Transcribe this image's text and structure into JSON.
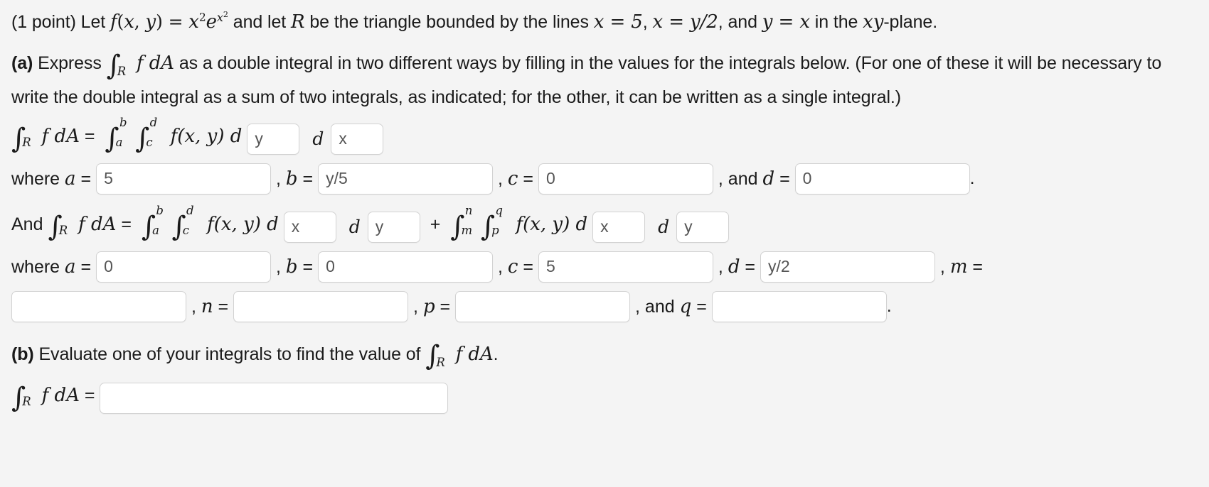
{
  "problem": {
    "points_label": "(1 point)",
    "intro_pre": "Let",
    "function_def": "f(x, y) = x²e^{x²}",
    "intro_mid": "and let",
    "region_symbol": "R",
    "intro_post": "be the triangle bounded by the lines",
    "line1": "x = 5",
    "line2": "x = y/2",
    "line3": "y = x",
    "plane": "in the xy-plane."
  },
  "part_a": {
    "label": "(a)",
    "text_1": "Express",
    "integral_symbol": "∫_R f dA",
    "text_2": "as a double integral in two different ways by filling in the values for the integrals below. (For one of these it will be necessary to write the double integral as a sum of two integrals, as indicated; for the other, it can be written as a single integral.)"
  },
  "equation_1": {
    "lhs": "∫_R f dA =",
    "integral_outer": {
      "lower": "a",
      "upper": "b"
    },
    "integral_inner": {
      "lower": "c",
      "upper": "d"
    },
    "integrand": "f(x, y) d",
    "d_label": "d",
    "var1_value": "y",
    "var2_value": "x",
    "where_label": "where a =",
    "a_value": "5",
    "b_label": ", b =",
    "b_value": "y/5",
    "c_label": ", c =",
    "c_value": "0",
    "d_label_text": ", and d =",
    "d_value": "0",
    "period": "."
  },
  "equation_2": {
    "and_label": "And",
    "lhs": "∫_R f dA =",
    "term1_outer": {
      "lower": "a",
      "upper": "b"
    },
    "term1_inner": {
      "lower": "c",
      "upper": "d"
    },
    "term1_integrand": "f(x, y) d",
    "term1_var1": "x",
    "term1_d": "d",
    "term1_var2": "y",
    "plus": "+",
    "term2_outer": {
      "lower": "m",
      "upper": "n"
    },
    "term2_inner": {
      "lower": "p",
      "upper": "q"
    },
    "term2_integrand": "f(x, y) d",
    "term2_var1": "x",
    "term2_d": "d",
    "term2_var2": "y",
    "where_label": "where a =",
    "a_value": "0",
    "b_label": ", b =",
    "b_value": "0",
    "c_label": ", c =",
    "c_value": "5",
    "d_label": ", d =",
    "d_value": "y/2",
    "m_label": ", m =",
    "m_value": "",
    "n_label": ", n =",
    "n_value": "",
    "p_label": ", p =",
    "p_value": "",
    "q_label": ", and q =",
    "q_value": "",
    "period": "."
  },
  "part_b": {
    "label": "(b)",
    "text": "Evaluate one of your integrals to find the value of",
    "integral_symbol": "∫_R f dA",
    "period": ".",
    "answer_lhs": "∫_R f dA =",
    "answer_value": ""
  },
  "theme": {
    "background": "#f4f4f4",
    "text_color": "#1a1a1a",
    "field_background": "#ffffff",
    "field_border": "#d2d2d2",
    "field_text": "#555555"
  }
}
